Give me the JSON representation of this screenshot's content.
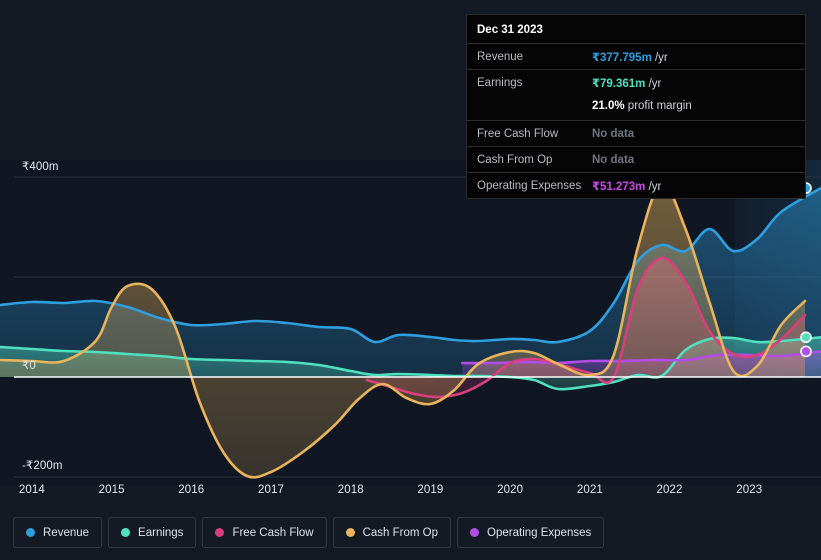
{
  "tooltip": {
    "date": "Dec 31 2023",
    "rows": [
      {
        "key": "Revenue",
        "value": "₹377.795m",
        "unit": "/yr",
        "color": "#2f9fe0",
        "nodata": false
      },
      {
        "key": "Earnings",
        "value": "₹79.361m",
        "unit": "/yr",
        "color": "#4fe0c0",
        "nodata": false
      },
      {
        "key": "",
        "value": "21.0%",
        "unit": "profit margin",
        "color": "#ffffff",
        "nodata": false,
        "sub": true
      },
      {
        "key": "Free Cash Flow",
        "value": "No data",
        "unit": "",
        "color": "#6f7480",
        "nodata": true
      },
      {
        "key": "Cash From Op",
        "value": "No data",
        "unit": "",
        "color": "#6f7480",
        "nodata": true
      },
      {
        "key": "Operating Expenses",
        "value": "₹51.273m",
        "unit": "/yr",
        "color": "#c44ce8",
        "nodata": false
      }
    ]
  },
  "legend": {
    "items": [
      {
        "label": "Revenue",
        "color": "#2f9fe0"
      },
      {
        "label": "Earnings",
        "color": "#4fe0c0"
      },
      {
        "label": "Free Cash Flow",
        "color": "#d83f7c"
      },
      {
        "label": "Cash From Op",
        "color": "#e9b45c"
      },
      {
        "label": "Operating Expenses",
        "color": "#b44ce8"
      }
    ]
  },
  "axes": {
    "y_ticks": [
      {
        "label": "₹400m",
        "value": 400
      },
      {
        "label": "₹0",
        "value": 0
      },
      {
        "label": "-₹200m",
        "value": -200
      }
    ],
    "x_ticks": [
      "2014",
      "2015",
      "2016",
      "2017",
      "2018",
      "2019",
      "2020",
      "2021",
      "2022",
      "2023"
    ]
  },
  "chart_data": {
    "type": "area",
    "title": "",
    "xlabel": "",
    "ylabel": "",
    "ylim": [
      -240,
      440
    ],
    "xlim": [
      2013.6,
      2023.9
    ],
    "grid": true,
    "legend_position": "bottom",
    "y_unit": "INR millions",
    "currency": "₹",
    "annotation": "Dec 31 2023",
    "series": [
      {
        "name": "Revenue",
        "color": "#2f9fe0",
        "x": [
          2013.6,
          2014.0,
          2014.4,
          2014.8,
          2015.2,
          2015.6,
          2016.0,
          2016.4,
          2016.8,
          2017.2,
          2017.6,
          2018.0,
          2018.3,
          2018.6,
          2019.0,
          2019.3,
          2019.6,
          2020.0,
          2020.3,
          2020.6,
          2021.0,
          2021.3,
          2021.6,
          2021.9,
          2022.2,
          2022.5,
          2022.8,
          2023.1,
          2023.4,
          2023.9
        ],
        "y": [
          144,
          150,
          148,
          152,
          140,
          118,
          104,
          106,
          112,
          108,
          100,
          96,
          70,
          84,
          80,
          74,
          72,
          76,
          74,
          70,
          92,
          148,
          232,
          264,
          252,
          296,
          252,
          276,
          330,
          377.795
        ]
      },
      {
        "name": "Earnings",
        "color": "#4fe0c0",
        "x": [
          2013.6,
          2014.0,
          2014.4,
          2014.8,
          2015.2,
          2015.6,
          2016.0,
          2016.4,
          2016.8,
          2017.2,
          2017.6,
          2018.0,
          2018.3,
          2018.6,
          2019.0,
          2019.3,
          2019.6,
          2020.0,
          2020.3,
          2020.6,
          2021.0,
          2021.3,
          2021.6,
          2021.9,
          2022.2,
          2022.5,
          2022.8,
          2023.1,
          2023.4,
          2023.9
        ],
        "y": [
          60,
          56,
          52,
          50,
          46,
          42,
          36,
          34,
          32,
          30,
          24,
          12,
          4,
          6,
          4,
          2,
          2,
          0,
          -6,
          -24,
          -18,
          -10,
          4,
          2,
          54,
          76,
          78,
          70,
          72,
          79.361
        ]
      },
      {
        "name": "Free Cash Flow",
        "color": "#d83f7c",
        "x": [
          2018.2,
          2018.5,
          2018.8,
          2019.1,
          2019.4,
          2019.7,
          2020.0,
          2020.3,
          2020.6,
          2021.0,
          2021.3,
          2021.6,
          2021.9,
          2022.2,
          2022.5,
          2022.8,
          2023.1,
          2023.4,
          2023.7
        ],
        "y": [
          -6,
          -20,
          -34,
          -40,
          -32,
          -8,
          28,
          36,
          26,
          8,
          0,
          176,
          238,
          190,
          92,
          46,
          44,
          76,
          124
        ]
      },
      {
        "name": "Cash From Op",
        "color": "#e9b45c",
        "x": [
          2013.6,
          2014.0,
          2014.4,
          2014.8,
          2015.0,
          2015.2,
          2015.5,
          2015.8,
          2016.1,
          2016.4,
          2016.7,
          2017.0,
          2017.4,
          2017.8,
          2018.1,
          2018.4,
          2018.7,
          2019.0,
          2019.3,
          2019.6,
          2020.0,
          2020.3,
          2020.6,
          2021.0,
          2021.3,
          2021.6,
          2021.9,
          2022.2,
          2022.5,
          2022.8,
          2023.1,
          2023.4,
          2023.7
        ],
        "y": [
          34,
          32,
          32,
          72,
          140,
          182,
          176,
          100,
          -48,
          -150,
          -198,
          -190,
          -150,
          -96,
          -44,
          -14,
          -42,
          -54,
          -26,
          26,
          50,
          48,
          26,
          4,
          44,
          258,
          386,
          296,
          150,
          12,
          22,
          104,
          152
        ]
      },
      {
        "name": "Operating Expenses",
        "color": "#b44ce8",
        "x": [
          2019.4,
          2019.8,
          2020.2,
          2020.6,
          2021.0,
          2021.4,
          2021.8,
          2022.2,
          2022.6,
          2023.0,
          2023.4,
          2023.9
        ],
        "y": [
          28,
          28,
          30,
          28,
          32,
          32,
          34,
          34,
          44,
          44,
          42,
          51.273
        ]
      }
    ],
    "end_markers": [
      {
        "series": "Revenue",
        "value": 377.795,
        "color": "#2f9fe0"
      },
      {
        "series": "Earnings",
        "value": 79.361,
        "color": "#4fe0c0"
      },
      {
        "series": "Operating Expenses",
        "value": 51.273,
        "color": "#b44ce8"
      }
    ]
  }
}
